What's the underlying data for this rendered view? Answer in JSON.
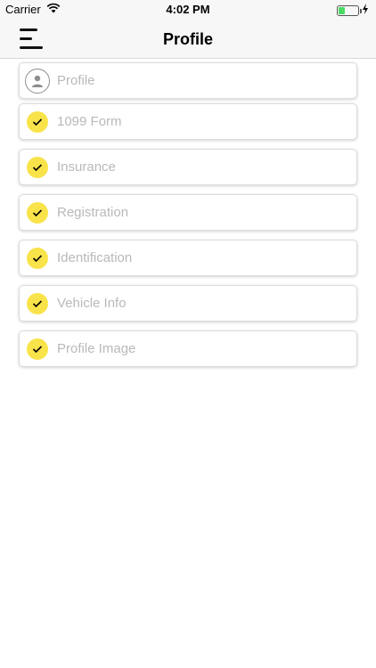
{
  "status_bar": {
    "carrier": "Carrier",
    "time": "4:02 PM",
    "battery_level": 0.35,
    "icons": [
      "wifi-icon",
      "battery-icon",
      "charging-bolt-icon"
    ]
  },
  "nav": {
    "title": "Profile",
    "menu_icon": "menu-icon"
  },
  "colors": {
    "check_fill": "#f9e34a",
    "label_gray": "#b9b9b9",
    "nav_background": "#f7f7f7"
  },
  "items": [
    {
      "label": "Profile",
      "icon": "user-avatar-icon"
    },
    {
      "label": "1099 Form",
      "icon": "checkmark-icon"
    },
    {
      "label": "Insurance",
      "icon": "checkmark-icon"
    },
    {
      "label": "Registration",
      "icon": "checkmark-icon"
    },
    {
      "label": "Identification",
      "icon": "checkmark-icon"
    },
    {
      "label": "Vehicle Info",
      "icon": "checkmark-icon"
    },
    {
      "label": "Profile Image",
      "icon": "checkmark-icon"
    }
  ]
}
